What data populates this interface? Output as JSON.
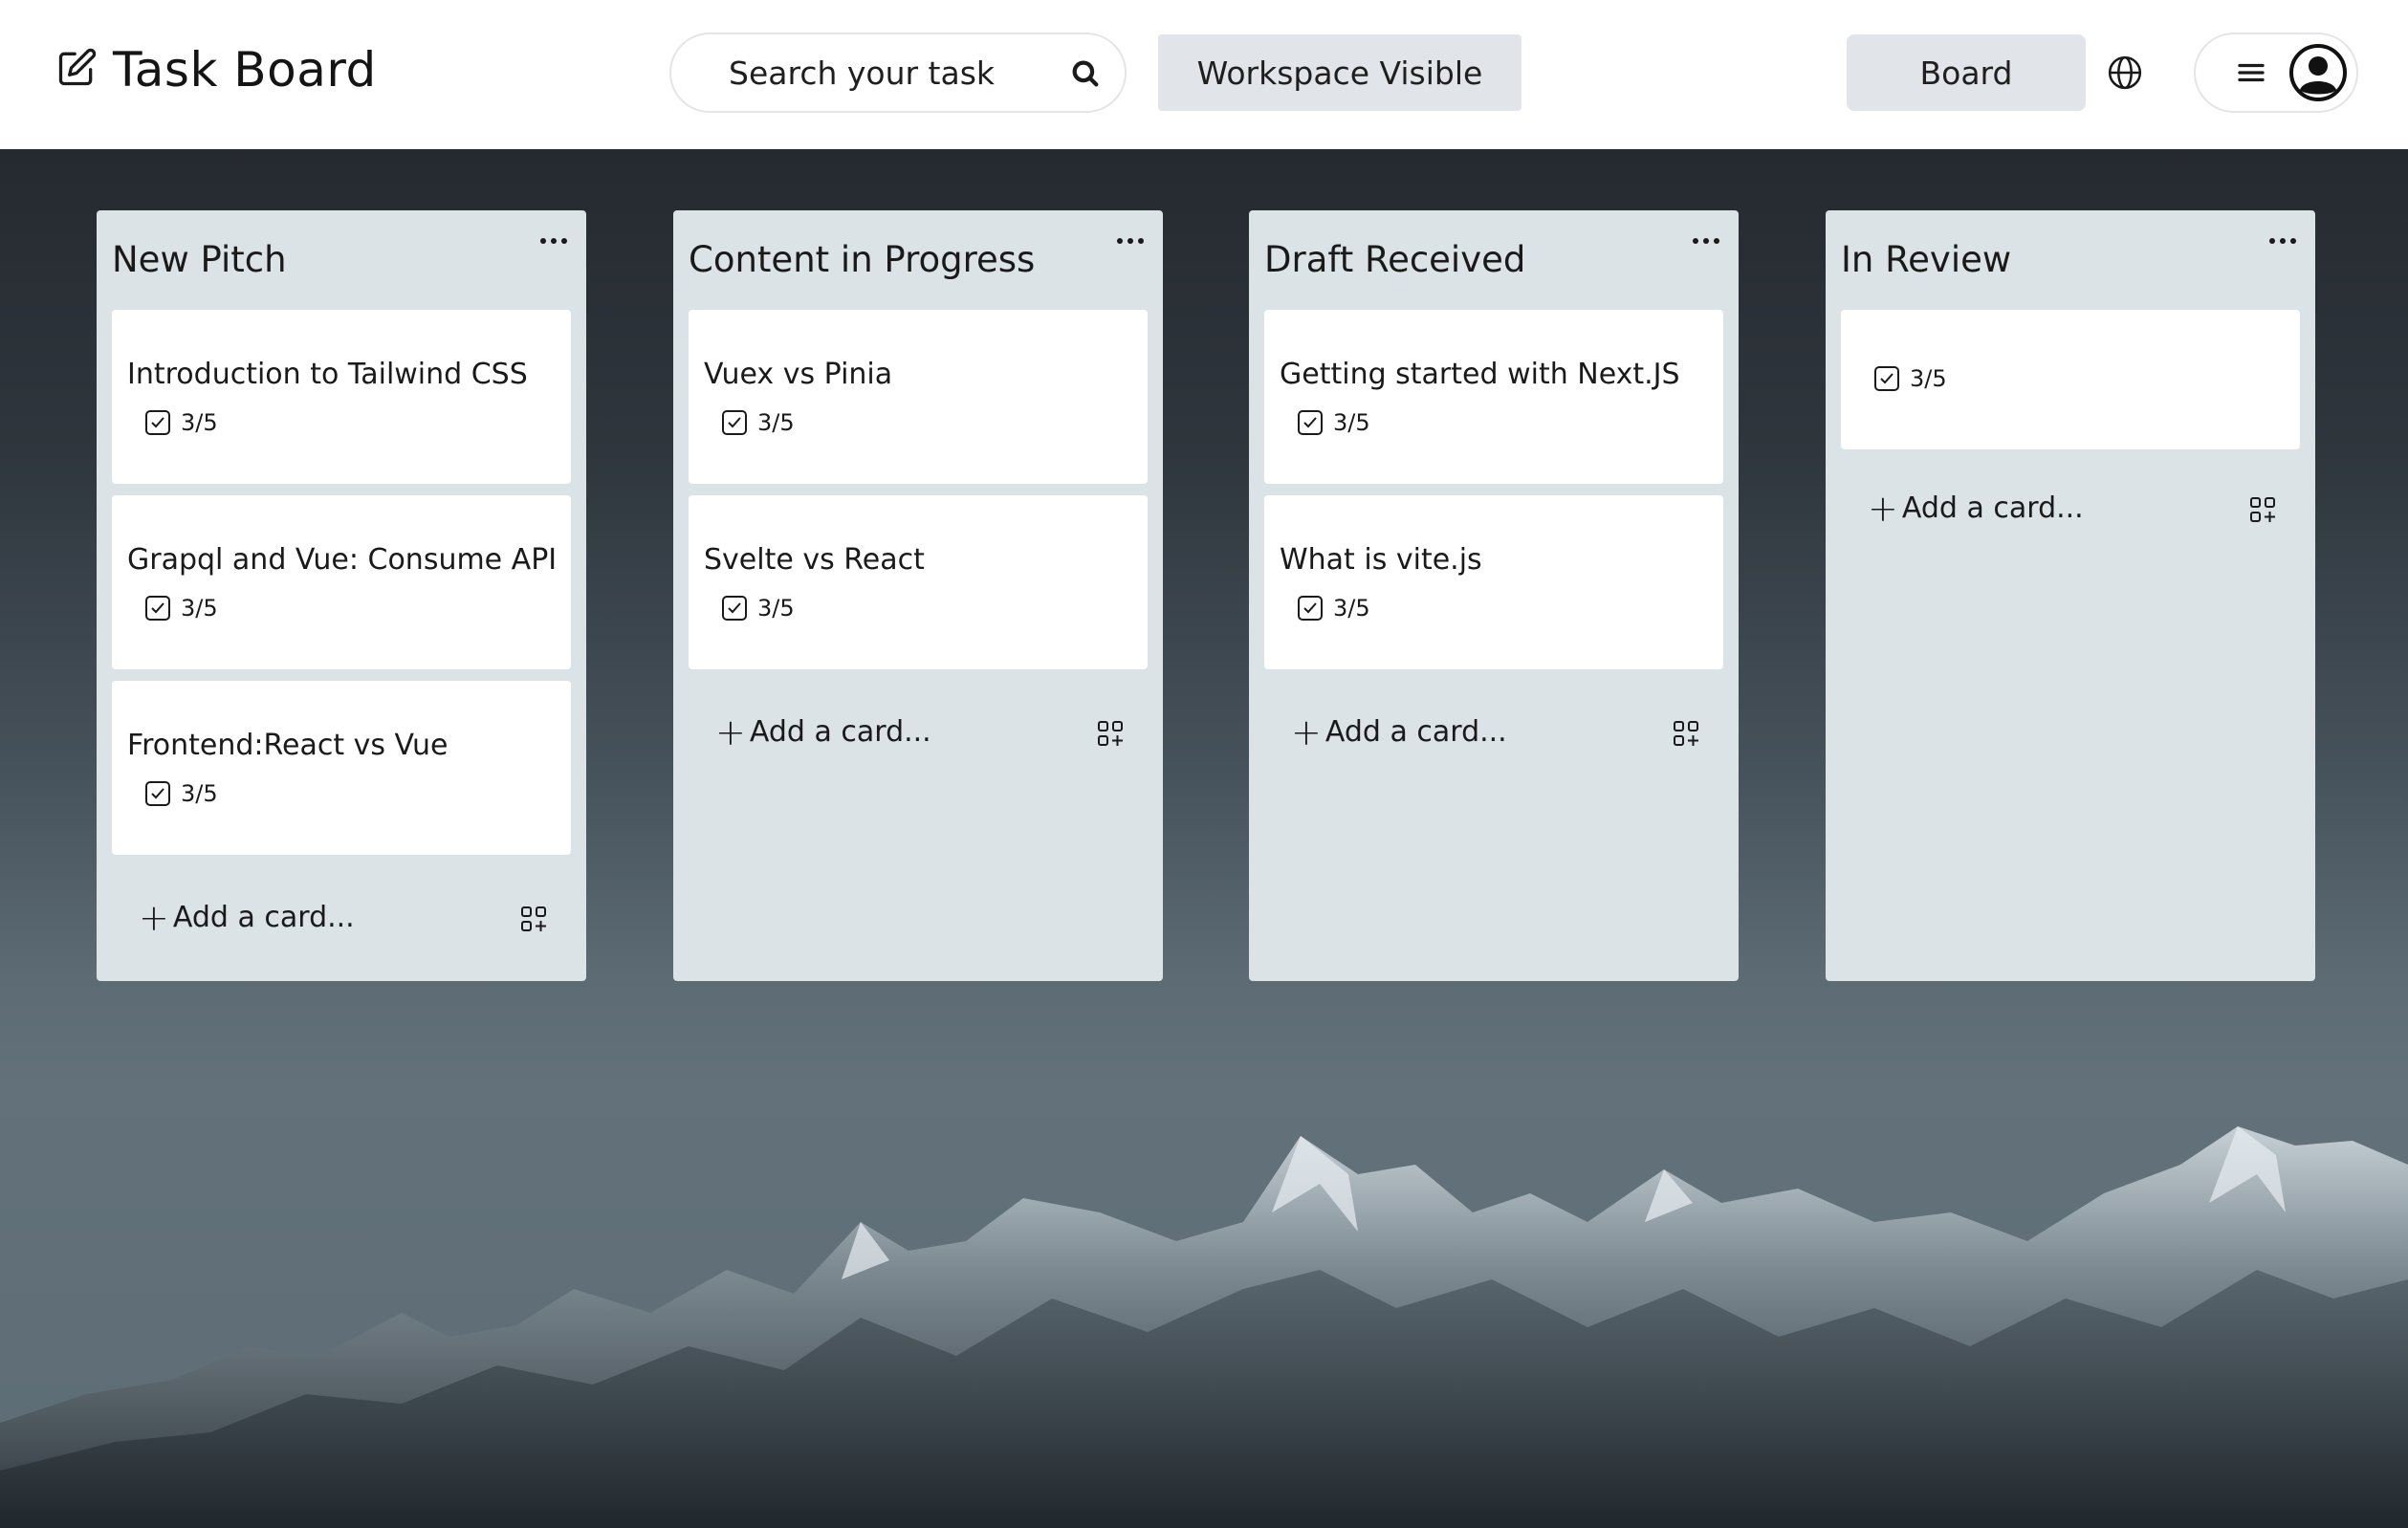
{
  "header": {
    "title": "Task Board",
    "search_placeholder": "Search your task",
    "workspace_label": "Workspace Visible",
    "board_label": "Board"
  },
  "icons": {
    "brand": "edit-icon",
    "search": "search-icon",
    "globe": "globe-icon",
    "menu": "hamburger-icon",
    "avatar": "user-avatar-icon",
    "list_menu": "more-horizontal-icon",
    "checklist": "checkbox-icon",
    "add": "plus-icon",
    "template": "template-add-icon"
  },
  "colors": {
    "list_bg": "#dbe3e6",
    "card_bg": "#ffffff",
    "button_bg": "#e1e4e8"
  },
  "add_card_label": "Add a card...",
  "lists": [
    {
      "title": "New Pitch",
      "cards": [
        {
          "title": "Introduction to Tailwind CSS",
          "checklist": "3/5"
        },
        {
          "title": "Grapql and Vue: Consume API",
          "checklist": "3/5"
        },
        {
          "title": "Frontend:React vs Vue",
          "checklist": "3/5"
        }
      ]
    },
    {
      "title": "Content in Progress",
      "cards": [
        {
          "title": "Vuex vs Pinia",
          "checklist": "3/5"
        },
        {
          "title": "Svelte vs React",
          "checklist": "3/5"
        }
      ]
    },
    {
      "title": "Draft Received",
      "cards": [
        {
          "title": "Getting started with Next.JS",
          "checklist": "3/5"
        },
        {
          "title": "What is vite.js",
          "checklist": "3/5"
        }
      ]
    },
    {
      "title": "In Review",
      "cards": [
        {
          "title": "",
          "checklist": "3/5"
        }
      ]
    }
  ]
}
